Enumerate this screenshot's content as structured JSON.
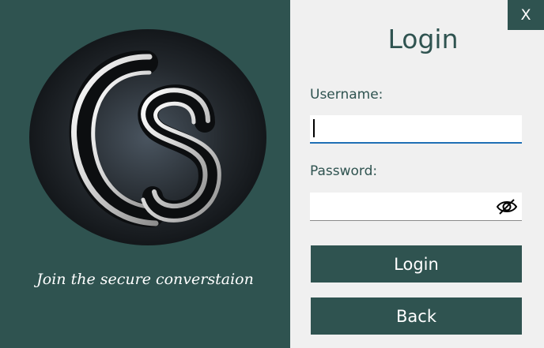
{
  "window": {
    "close_label": "X"
  },
  "branding": {
    "logo_icon": "cs-monogram-logo",
    "tagline": "Join the secure converstaion"
  },
  "form": {
    "title": "Login",
    "username_label": "Username:",
    "username_value": "",
    "password_label": "Password:",
    "password_value": "",
    "password_toggle_icon": "eye-slash-icon",
    "login_button": "Login",
    "back_button": "Back"
  },
  "colors": {
    "primary": "#2f5350",
    "panel_bg": "#f0f0f0",
    "focus_underline": "#1f6fb5"
  }
}
